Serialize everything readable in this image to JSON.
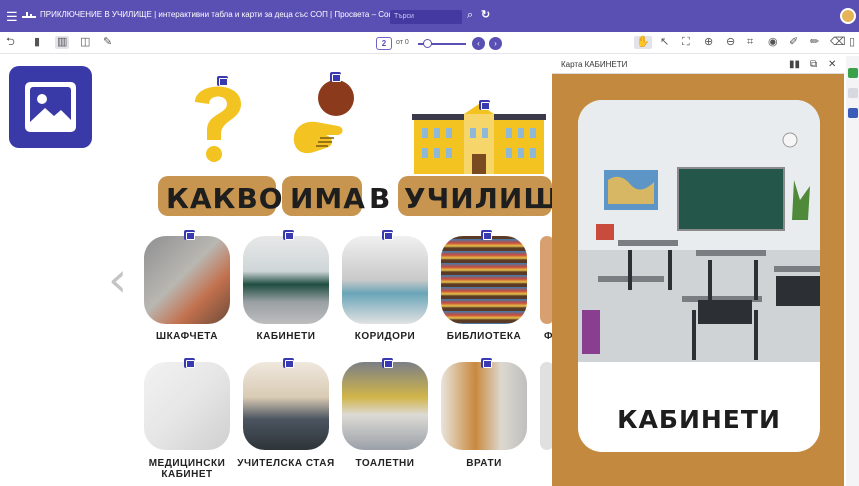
{
  "topbar": {
    "title": "ПРИКЛЮЧЕНИЕ В УЧИЛИЩЕ | интерактивни табла и карти за деца със СОП | Просвета – София",
    "search_placeholder": "Търси",
    "menu_icon": "☰",
    "search_icon": "⌕",
    "refresh_icon": "↻"
  },
  "toolbar": {
    "page_current": "2",
    "page_of": "от 0",
    "prev": "‹",
    "next": "›"
  },
  "board": {
    "heading_words": [
      "КАКВО",
      "ИМА",
      "В",
      "УЧИЛИЩЕ"
    ],
    "tiles": [
      {
        "label": "ШКАФЧЕТА"
      },
      {
        "label": "КАБИНЕТИ"
      },
      {
        "label": "КОРИДОРИ"
      },
      {
        "label": "БИБЛИОТЕКА"
      },
      {
        "label": "Ф"
      },
      {
        "label": "МЕДИЦИНСКИ\nКАБИНЕТ"
      },
      {
        "label": "УЧИТЕЛСКА СТАЯ"
      },
      {
        "label": "ТОАЛЕТНИ"
      },
      {
        "label": "ВРАТИ"
      }
    ]
  },
  "panel": {
    "title": "Карта КАБИНЕТИ",
    "card_label": "КАБИНЕТИ"
  },
  "colors": {
    "brand": "#5a4fb3",
    "panel_bg": "#c38a3f",
    "heading_bg": "#c79550",
    "question_yellow": "#f3c322"
  }
}
